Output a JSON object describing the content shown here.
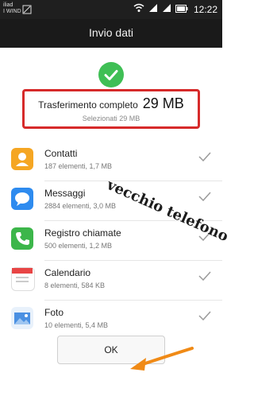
{
  "status_bar": {
    "carrier_line1": "iliad",
    "carrier_line2": "I WIND",
    "time": "12:22"
  },
  "header": {
    "title": "Invio dati"
  },
  "summary": {
    "label": "Trasferimento completo",
    "size": "29 MB",
    "selected": "Selezionati 29 MB"
  },
  "items": [
    {
      "title": "Contatti",
      "subtitle": "187 elementi, 1,7 MB",
      "icon": "contacts-icon",
      "color": "#f5a623"
    },
    {
      "title": "Messaggi",
      "subtitle": "2884 elementi, 3,0 MB",
      "icon": "messages-icon",
      "color": "#2e8bef"
    },
    {
      "title": "Registro chiamate",
      "subtitle": "500 elementi, 1,2 MB",
      "icon": "phone-icon",
      "color": "#3cb64a"
    },
    {
      "title": "Calendario",
      "subtitle": "8 elementi, 584 KB",
      "icon": "calendar-icon",
      "color": "#e84545"
    },
    {
      "title": "Foto",
      "subtitle": "10 elementi, 5,4 MB",
      "icon": "photo-icon",
      "color": "#4a90e2"
    }
  ],
  "watermark": "vecchio telefono",
  "ok_label": "OK"
}
